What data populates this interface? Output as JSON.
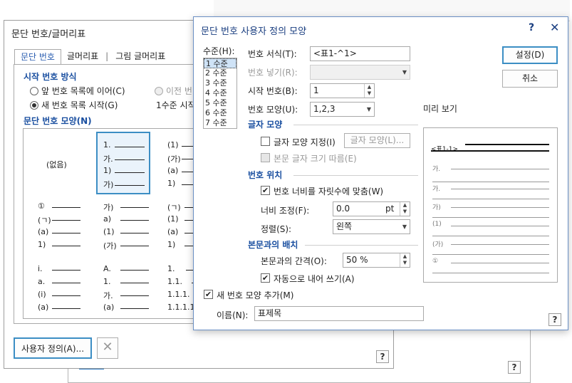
{
  "parent": {
    "title": "문단 번호/글머리표",
    "tabs": [
      "문단 번호",
      "글머리표",
      "그림 글머리표"
    ],
    "start_section": "시작 번호 방식",
    "radio_continue": "앞 번호 목록에 이어(C)",
    "radio_prev": "이전 번",
    "radio_new": "새 번호 목록 시작(G)",
    "level_start_text": "1수준 시작",
    "shape_section": "문단 번호 모양(N)",
    "grid": [
      [
        "(없음)"
      ],
      [
        "1.",
        "가.",
        "1)",
        "가)"
      ],
      [
        "(1)",
        "(가)",
        "(a)",
        "1)"
      ],
      [
        "①",
        "(ㄱ)",
        "(a)",
        "1)"
      ],
      [
        "가)",
        "a)",
        "(1)",
        "(가)"
      ],
      [
        "(ㄱ)",
        "(1)",
        "(a)",
        "1)"
      ],
      [
        "i.",
        "a.",
        "(i)",
        "(a)"
      ],
      [
        "A.",
        "1.",
        "가.",
        "(a)"
      ],
      [
        "1.",
        "1.1.",
        "1.1.1.",
        "1.1.1.1."
      ]
    ],
    "custom_button": "사용자 정의(A)...",
    "delete_icon": "close-x",
    "help": "?"
  },
  "dialog": {
    "title": "문단 번호 사용자 정의 모양",
    "help": "?",
    "close": "✕",
    "level_label": "수준(H):",
    "levels": [
      "1 수준",
      "2 수준",
      "3 수준",
      "4 수준",
      "5 수준",
      "6 수준",
      "7 수준"
    ],
    "fmt_label": "번호 서식(T):",
    "fmt_value": "<표1-^1>",
    "insert_label": "번호 넣기(R):",
    "start_label": "시작 번호(B):",
    "start_value": "1",
    "shape_label": "번호 모양(U):",
    "shape_value": "1,2,3",
    "font_section": "글자 모양",
    "font_check": "글자 모양 지정(I)",
    "font_button": "글자 모양(L)...",
    "font_size_check": "본문 글자 크기 따름(E)",
    "pos_section": "번호 위치",
    "pos_check": "번호 너비를 자릿수에 맞춤(W)",
    "width_label": "너비 조정(F):",
    "width_value": "0.0",
    "width_unit": "pt",
    "align_label": "정렬(S):",
    "align_value": "왼쪽",
    "body_section": "본문과의 배치",
    "gap_label": "본문과의 간격(O):",
    "gap_value": "50 %",
    "auto_indent": "자동으로 내어 쓰기(A)",
    "add_shape": "새 번호 모양 추가(M)",
    "name_label": "이름(N):",
    "name_value": "표제목",
    "ok": "설정(D)",
    "cancel": "취소",
    "preview_label": "미리 보기",
    "preview_first": "<표1-1>",
    "preview_items": [
      "가.",
      "가.",
      "가)",
      "(1)",
      "(가)",
      "①"
    ]
  },
  "background": {
    "help": "?"
  }
}
